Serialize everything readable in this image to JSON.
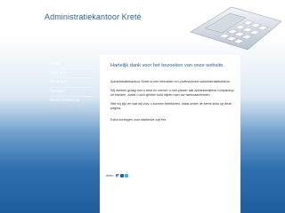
{
  "site": {
    "title": "Administratiekantoor Kreté"
  },
  "nav": {
    "items": [
      {
        "label": "Home"
      },
      {
        "label": "Over ons"
      },
      {
        "label": "Werkwijze"
      },
      {
        "label": "Tarieven"
      },
      {
        "label": "Neem contact op"
      }
    ]
  },
  "content": {
    "welcome": "Hartelijk dank voor het bezoeken van onze website.",
    "paragraphs": [
      "Administratiekantoor Kreté is een betrokken en professioneel administratiekantoor.",
      "Wij denken graag met u mee en nemen u met plezier alle administratieve rompslomp uit handen, zodat u zich geheel kunt wijden aan uw werkzaamheden.",
      "Wie wij zijn en wat wij voor u kunnen betekenen, staat onder de items links op deze pagina.",
      "Extra kortingen voor startende zzp'ers."
    ]
  },
  "share": {
    "label": "delen",
    "icons": [
      "delicious-icon",
      "facebook-icon",
      "twitter-icon"
    ]
  },
  "colors": {
    "title": "#2d5f95",
    "background_dark": "#1f5e9d",
    "panel": "#ffffff"
  }
}
